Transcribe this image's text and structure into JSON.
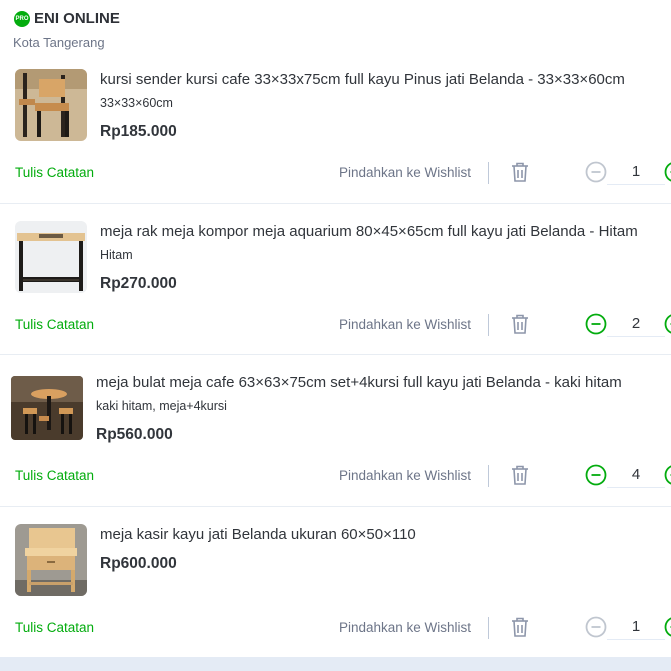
{
  "shop": {
    "badge": "PRO",
    "name": "ENI ONLINE",
    "city": "Kota Tangerang"
  },
  "actions": {
    "note_label": "Tulis Catatan",
    "wishlist_label": "Pindahkan ke Wishlist"
  },
  "items": [
    {
      "title": "kursi sender kursi cafe 33×33x75cm full kayu Pinus jati Belanda - 33×33×60cm",
      "variant": "33×33×60cm",
      "price": "Rp185.000",
      "quantity": "1",
      "minus_enabled": false
    },
    {
      "title": "meja rak meja kompor meja aquarium 80×45×65cm full kayu jati Belanda - Hitam",
      "variant": "Hitam",
      "price": "Rp270.000",
      "quantity": "2",
      "minus_enabled": true
    },
    {
      "title": "meja bulat meja cafe 63×63×75cm set+4kursi full kayu jati Belanda - kaki hitam",
      "variant": "kaki hitam, meja+4kursi",
      "price": "Rp560.000",
      "quantity": "4",
      "minus_enabled": true
    },
    {
      "title": "meja kasir kayu jati Belanda ukuran 60×50×110",
      "variant": "",
      "price": "Rp600.000",
      "quantity": "1",
      "minus_enabled": false
    }
  ],
  "colors": {
    "brand_green": "#03ac0e",
    "disabled_gray": "#c0c6cf",
    "text_dark": "#31353b",
    "text_muted": "#6d7588"
  }
}
